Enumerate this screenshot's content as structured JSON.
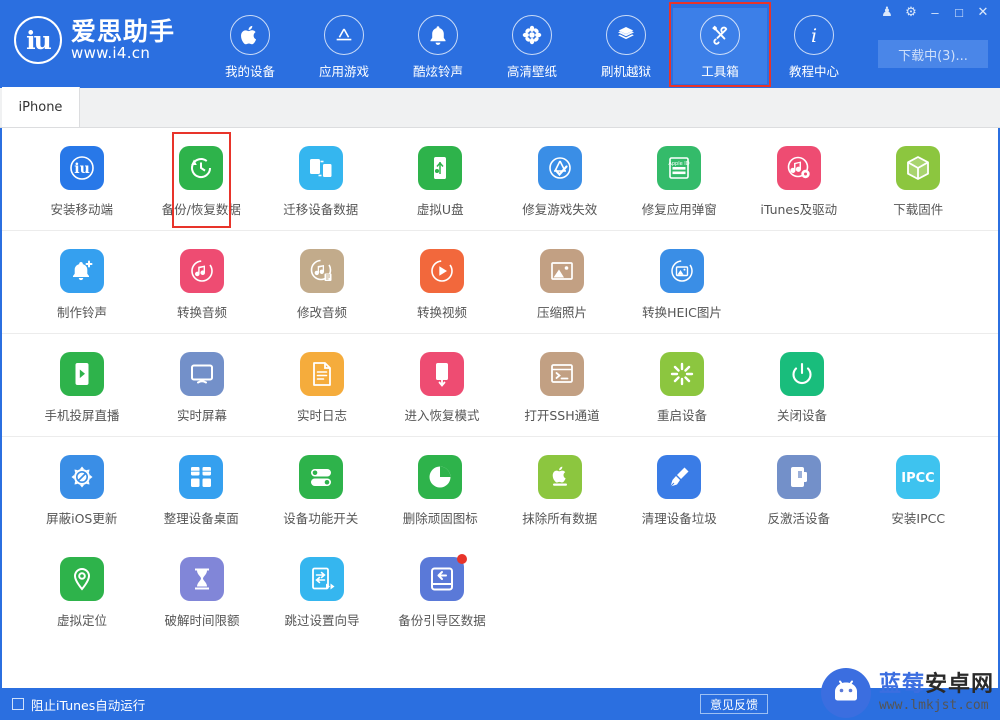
{
  "app": {
    "brand_mark": "iu",
    "brand_name": "爱思助手",
    "brand_url": "www.i4.cn",
    "accent_blue": "#2b6fe0",
    "highlight_red": "#e8342a"
  },
  "window_controls": [
    {
      "name": "skin-icon",
      "glyph": "♟"
    },
    {
      "name": "settings-icon",
      "glyph": "⚙"
    },
    {
      "name": "minimize-icon",
      "glyph": "–"
    },
    {
      "name": "maximize-icon",
      "glyph": "□"
    },
    {
      "name": "close-icon",
      "glyph": "✕"
    }
  ],
  "header": {
    "download_button": "下载中(3)...",
    "nav": [
      {
        "label": "我的设备",
        "icon": "apple-icon",
        "active": false,
        "highlight": false
      },
      {
        "label": "应用游戏",
        "icon": "appstore-icon",
        "active": false,
        "highlight": false
      },
      {
        "label": "酷炫铃声",
        "icon": "bell-icon",
        "active": false,
        "highlight": false
      },
      {
        "label": "高清壁纸",
        "icon": "flower-icon",
        "active": false,
        "highlight": false
      },
      {
        "label": "刷机越狱",
        "icon": "box-open-icon",
        "active": false,
        "highlight": false
      },
      {
        "label": "工具箱",
        "icon": "tools-icon",
        "active": true,
        "highlight": true
      },
      {
        "label": "教程中心",
        "icon": "info-icon",
        "active": false,
        "highlight": false
      }
    ]
  },
  "tabs": [
    {
      "label": "iPhone",
      "active": true
    }
  ],
  "tool_groups": [
    {
      "rows": [
        [
          {
            "label": "安装移动端",
            "icon": "i4-app-icon",
            "color": "#2878e8",
            "highlight": false
          },
          {
            "label": "备份/恢复数据",
            "icon": "backup-restore-icon",
            "color": "#2eb34b",
            "highlight": true
          },
          {
            "label": "迁移设备数据",
            "icon": "migrate-device-icon",
            "color": "#35b6ef",
            "highlight": false
          },
          {
            "label": "虚拟U盘",
            "icon": "usb-drive-icon",
            "color": "#2eb34b",
            "highlight": false
          },
          {
            "label": "修复游戏失效",
            "icon": "appstore-fix-icon",
            "color": "#3a8ee6",
            "highlight": false
          },
          {
            "label": "修复应用弹窗",
            "icon": "appleid-card-icon",
            "color": "#34bb6a",
            "highlight": false
          },
          {
            "label": "iTunes及驱动",
            "icon": "itunes-gear-icon",
            "color": "#ee4c72",
            "highlight": false
          },
          {
            "label": "下载固件",
            "icon": "firmware-box-icon",
            "color": "#8cc63f",
            "highlight": false
          }
        ]
      ]
    },
    {
      "rows": [
        [
          {
            "label": "制作铃声",
            "icon": "ringtone-add-icon",
            "color": "#35a0ef",
            "highlight": false
          },
          {
            "label": "转换音频",
            "icon": "convert-audio-icon",
            "color": "#ee4c72",
            "highlight": false
          },
          {
            "label": "修改音频",
            "icon": "edit-audio-icon",
            "color": "#c2ab8b",
            "highlight": false
          },
          {
            "label": "转换视频",
            "icon": "convert-video-icon",
            "color": "#f2683c",
            "highlight": false
          },
          {
            "label": "压缩照片",
            "icon": "compress-photo-icon",
            "color": "#c2a083",
            "highlight": false
          },
          {
            "label": "转换HEIC图片",
            "icon": "heic-convert-icon",
            "color": "#3a8ee6",
            "highlight": false
          }
        ]
      ]
    },
    {
      "rows": [
        [
          {
            "label": "手机投屏直播",
            "icon": "screen-cast-icon",
            "color": "#2eb34b",
            "highlight": false
          },
          {
            "label": "实时屏幕",
            "icon": "live-screen-icon",
            "color": "#7390c9",
            "highlight": false
          },
          {
            "label": "实时日志",
            "icon": "live-log-icon",
            "color": "#f5ac3c",
            "highlight": false
          },
          {
            "label": "进入恢复模式",
            "icon": "recovery-mode-icon",
            "color": "#ee4c72",
            "highlight": false
          },
          {
            "label": "打开SSH通道",
            "icon": "ssh-terminal-icon",
            "color": "#c2a083",
            "highlight": false
          },
          {
            "label": "重启设备",
            "icon": "reboot-icon",
            "color": "#8cc63f",
            "highlight": false
          },
          {
            "label": "关闭设备",
            "icon": "power-off-icon",
            "color": "#19bd7c",
            "highlight": false
          }
        ]
      ]
    },
    {
      "rows": [
        [
          {
            "label": "屏蔽iOS更新",
            "icon": "block-update-icon",
            "color": "#3a8ee6",
            "highlight": false
          },
          {
            "label": "整理设备桌面",
            "icon": "arrange-desktop-icon",
            "color": "#35a0ef",
            "highlight": false
          },
          {
            "label": "设备功能开关",
            "icon": "feature-toggle-icon",
            "color": "#2eb34b",
            "highlight": false
          },
          {
            "label": "删除顽固图标",
            "icon": "delete-icon-icon",
            "color": "#2eb34b",
            "highlight": false
          },
          {
            "label": "抹除所有数据",
            "icon": "erase-data-icon",
            "color": "#8cc63f",
            "highlight": false
          },
          {
            "label": "清理设备垃圾",
            "icon": "clean-junk-icon",
            "color": "#3a7ce6",
            "highlight": false
          },
          {
            "label": "反激活设备",
            "icon": "deactivate-icon",
            "color": "#7390c9",
            "highlight": false
          },
          {
            "label": "安装IPCC",
            "icon": "ipcc-icon",
            "color": "#3ec3ef",
            "highlight": false,
            "text": "IPCC"
          }
        ],
        [
          {
            "label": "虚拟定位",
            "icon": "virtual-location-icon",
            "color": "#2eb34b",
            "highlight": false
          },
          {
            "label": "破解时间限额",
            "icon": "screentime-icon",
            "color": "#8186d8",
            "highlight": false
          },
          {
            "label": "跳过设置向导",
            "icon": "skip-setup-icon",
            "color": "#35b6ef",
            "highlight": false
          },
          {
            "label": "备份引导区数据",
            "icon": "backup-boot-icon",
            "color": "#5a79d8",
            "highlight": false,
            "badge": true
          }
        ]
      ]
    }
  ],
  "footer": {
    "block_itunes_label": "阻止iTunes自动运行",
    "block_itunes_checked": false,
    "feedback_label": "意见反馈"
  },
  "watermark": {
    "name_part1": "蓝莓",
    "name_part2": "安卓网",
    "url": "www.lmkjst.com"
  }
}
